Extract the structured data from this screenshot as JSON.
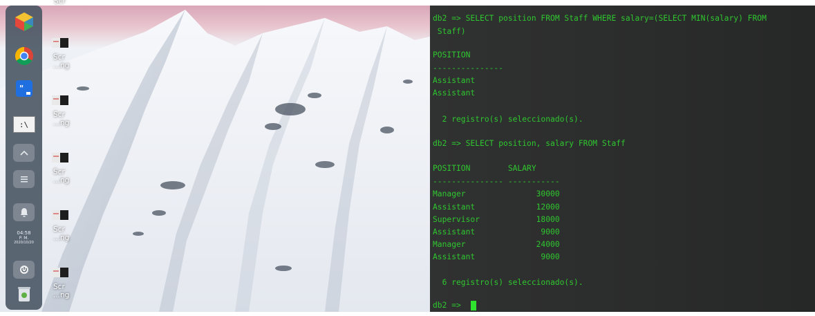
{
  "desktop": {
    "icon_label_line1": "Scr",
    "icon_label_line2": "...ng",
    "top_cut_label": "Scr"
  },
  "dock": {
    "clock_time": "04:58",
    "clock_period": "P. M.",
    "clock_date": "2020/10/20",
    "terminal_icon_text": ":\\"
  },
  "terminal": {
    "lines": [
      "db2 => SELECT position FROM Staff WHERE salary=(SELECT MIN(salary) FROM",
      " Staff)",
      "",
      "POSITION",
      "---------------",
      "Assistant",
      "Assistant",
      "",
      "  2 registro(s) seleccionado(s).",
      "",
      "db2 => SELECT position, salary FROM Staff",
      "",
      "POSITION        SALARY",
      "--------------- -----------",
      "Manager               30000",
      "Assistant             12000",
      "Supervisor            18000",
      "Assistant              9000",
      "Manager               24000",
      "Assistant              9000",
      "",
      "  6 registro(s) seleccionado(s).",
      "",
      "db2 => "
    ]
  },
  "colors": {
    "terminal_text": "#2fc72f",
    "terminal_bg": "#2b2c2c",
    "dock_bg": "#465260"
  }
}
